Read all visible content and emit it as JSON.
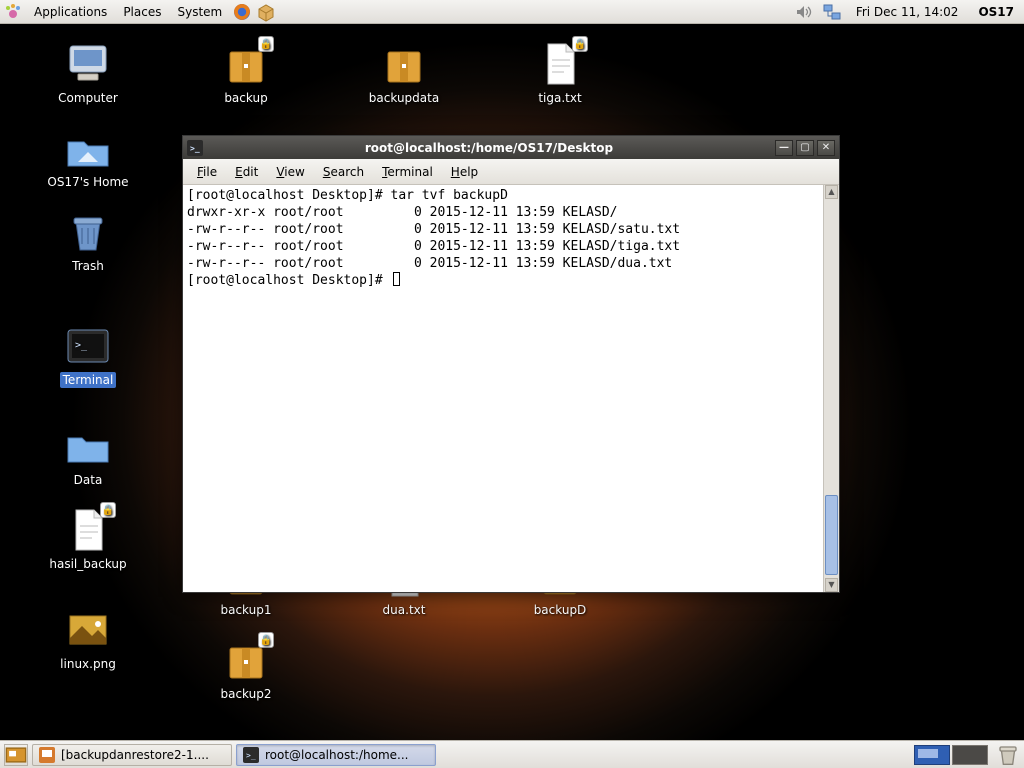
{
  "top_panel": {
    "menus": {
      "applications": "Applications",
      "places": "Places",
      "system": "System"
    },
    "clock": "Fri Dec 11, 14:02",
    "user": "OS17"
  },
  "desktop_icons": {
    "computer": {
      "label": "Computer"
    },
    "home": {
      "label": "OS17's Home"
    },
    "trash": {
      "label": "Trash"
    },
    "terminal": {
      "label": "Terminal"
    },
    "data": {
      "label": "Data"
    },
    "hasil": {
      "label": "hasil_backup"
    },
    "linuxpng": {
      "label": "linux.png"
    },
    "backup": {
      "label": "backup"
    },
    "backup1": {
      "label": "backup1"
    },
    "backup2": {
      "label": "backup2"
    },
    "backupdata": {
      "label": "backupdata"
    },
    "dua": {
      "label": "dua.txt"
    },
    "tiga": {
      "label": "tiga.txt"
    },
    "backupD": {
      "label": "backupD"
    }
  },
  "terminal": {
    "title": "root@localhost:/home/OS17/Desktop",
    "menus": {
      "file": "File",
      "edit": "Edit",
      "view": "View",
      "search": "Search",
      "terminal": "Terminal",
      "help": "Help"
    },
    "lines": [
      "[root@localhost Desktop]# tar tvf backupD",
      "drwxr-xr-x root/root         0 2015-12-11 13:59 KELASD/",
      "-rw-r--r-- root/root         0 2015-12-11 13:59 KELASD/satu.txt",
      "-rw-r--r-- root/root         0 2015-12-11 13:59 KELASD/tiga.txt",
      "-rw-r--r-- root/root         0 2015-12-11 13:59 KELASD/dua.txt",
      "[root@localhost Desktop]# "
    ]
  },
  "taskbar": {
    "task1": "[backupdanrestore2-1....",
    "task2": "root@localhost:/home..."
  }
}
